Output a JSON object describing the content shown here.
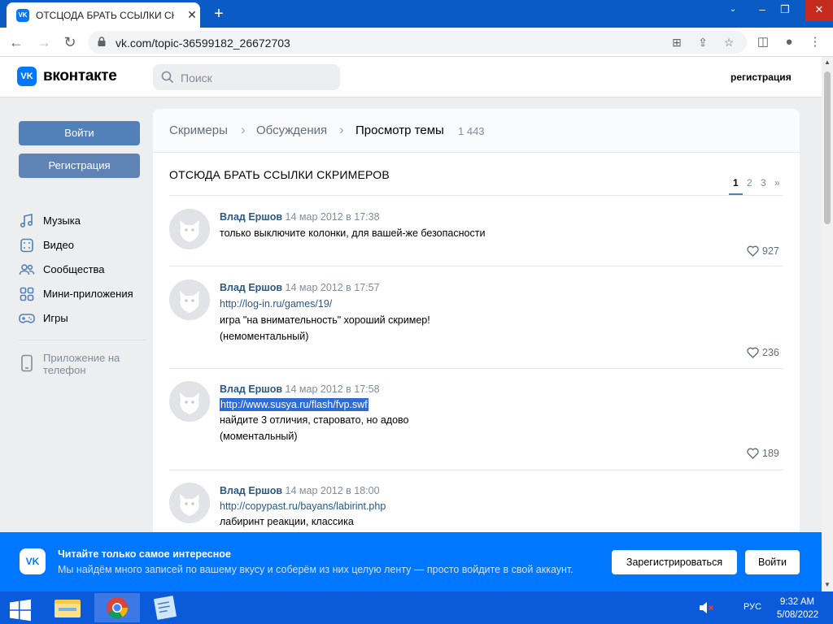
{
  "browser": {
    "tab_title": "ОТСЦОДА БРАТЬ ССЫЛКИ СКРИ",
    "url": "vk.com/topic-36599182_26672703"
  },
  "vk": {
    "brand": "вконтакте",
    "search_placeholder": "Поиск",
    "register_link": "регистрация",
    "login_button": "Войти",
    "register_button": "Регистрация",
    "menu": [
      {
        "label": "Музыка",
        "icon": "music-icon"
      },
      {
        "label": "Видео",
        "icon": "video-icon"
      },
      {
        "label": "Сообщества",
        "icon": "community-icon"
      },
      {
        "label": "Мини-приложения",
        "icon": "apps-icon"
      },
      {
        "label": "Игры",
        "icon": "gamepad-icon"
      }
    ],
    "mobile_app": "Приложение на телефон"
  },
  "breadcrumbs": [
    "Скримеры",
    "Обсуждения",
    "Просмотр темы"
  ],
  "view_count": "1 443",
  "topic_title": "ОТСЮДА БРАТЬ ССЫЛКИ СКРИМЕРОВ",
  "pagination": [
    "1",
    "2",
    "3",
    "»"
  ],
  "posts": [
    {
      "author": "Влад Ершов",
      "date": "14 мар 2012 в 17:38",
      "lines": [
        "только выключите колонки, для вашей-же безопасности"
      ],
      "likes": "927"
    },
    {
      "author": "Влад Ершов",
      "date": "14 мар 2012 в 17:57",
      "lines": [
        "http://log-in.ru/games/19/",
        "игра \"на внимательность\" хороший скример!",
        "(немоментальный)"
      ],
      "likes": "236"
    },
    {
      "author": "Влад Ершов",
      "date": "14 мар 2012 в 17:58",
      "lines": [
        "http://www.susya.ru/flash/fvp.swf",
        "найдите 3 отличия, старовато, но адово",
        "(моментальный)"
      ],
      "likes": "189"
    },
    {
      "author": "Влад Ершов",
      "date": "14 мар 2012 в 18:00",
      "lines": [
        "http://copypast.ru/bayans/labirint.php",
        "лабиринт реакции, классика"
      ],
      "likes": ""
    }
  ],
  "promo": {
    "title": "Читайте только самое интересное",
    "subtitle": "Мы найдём много записей по вашему вкусу и соберём из них целую ленту — просто войдите в свой аккаунт.",
    "register_button": "Зарегистрироваться",
    "login_button": "Войти"
  },
  "taskbar": {
    "language": "РУС",
    "time": "9:32 AM",
    "date": "5/08/2022"
  },
  "colors": {
    "vk_blue": "#0077ff",
    "link": "#2a5885",
    "button": "#5181b8",
    "taskbar": "#0b5ad9"
  }
}
